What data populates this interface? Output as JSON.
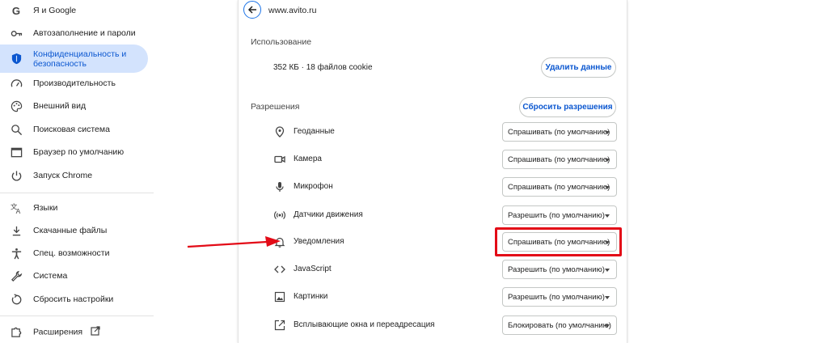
{
  "sidebar": {
    "items": [
      {
        "label": "Я и Google",
        "icon": "google-g-icon"
      },
      {
        "label": "Автозаполнение и пароли",
        "icon": "key-icon"
      },
      {
        "label": "Конфиденциальность и безопасность",
        "icon": "shield-icon",
        "active": true
      },
      {
        "label": "Производительность",
        "icon": "speedometer-icon"
      },
      {
        "label": "Внешний вид",
        "icon": "palette-icon"
      },
      {
        "label": "Поисковая система",
        "icon": "search-icon"
      },
      {
        "label": "Браузер по умолчанию",
        "icon": "browser-window-icon"
      },
      {
        "label": "Запуск Chrome",
        "icon": "power-icon"
      },
      {
        "label": "Языки",
        "icon": "translate-icon"
      },
      {
        "label": "Скачанные файлы",
        "icon": "download-icon"
      },
      {
        "label": "Спец. возможности",
        "icon": "accessibility-icon"
      },
      {
        "label": "Система",
        "icon": "wrench-icon"
      },
      {
        "label": "Сбросить настройки",
        "icon": "reset-icon"
      },
      {
        "label": "Расширения",
        "icon": "puzzle-icon"
      }
    ]
  },
  "site": {
    "url": "www.avito.ru"
  },
  "usage": {
    "title": "Использование",
    "text": "352 КБ · 18 файлов cookie",
    "delete_button": "Удалить данные"
  },
  "permissions": {
    "title": "Разрешения",
    "reset_button": "Сбросить разрешения",
    "rows": [
      {
        "label": "Геоданные",
        "value": "Спрашивать (по умолчанию)",
        "icon": "location-pin-icon"
      },
      {
        "label": "Камера",
        "value": "Спрашивать (по умолчанию)",
        "icon": "camera-icon"
      },
      {
        "label": "Микрофон",
        "value": "Спрашивать (по умолчанию)",
        "icon": "microphone-icon"
      },
      {
        "label": "Датчики движения",
        "value": "Разрешить (по умолчанию)",
        "icon": "motion-sensor-icon"
      },
      {
        "label": "Уведомления",
        "value": "Спрашивать (по умолчанию)",
        "icon": "bell-icon"
      },
      {
        "label": "JavaScript",
        "value": "Разрешить (по умолчанию)",
        "icon": "code-icon"
      },
      {
        "label": "Картинки",
        "value": "Разрешить (по умолчанию)",
        "icon": "image-icon"
      },
      {
        "label": "Всплывающие окна и переадресация",
        "value": "Блокировать (по умолчанию)",
        "icon": "popup-icon"
      }
    ]
  },
  "colors": {
    "accent": "#0b57d0",
    "active_bg": "#d3e3fd",
    "annotation": "#e30b17"
  }
}
